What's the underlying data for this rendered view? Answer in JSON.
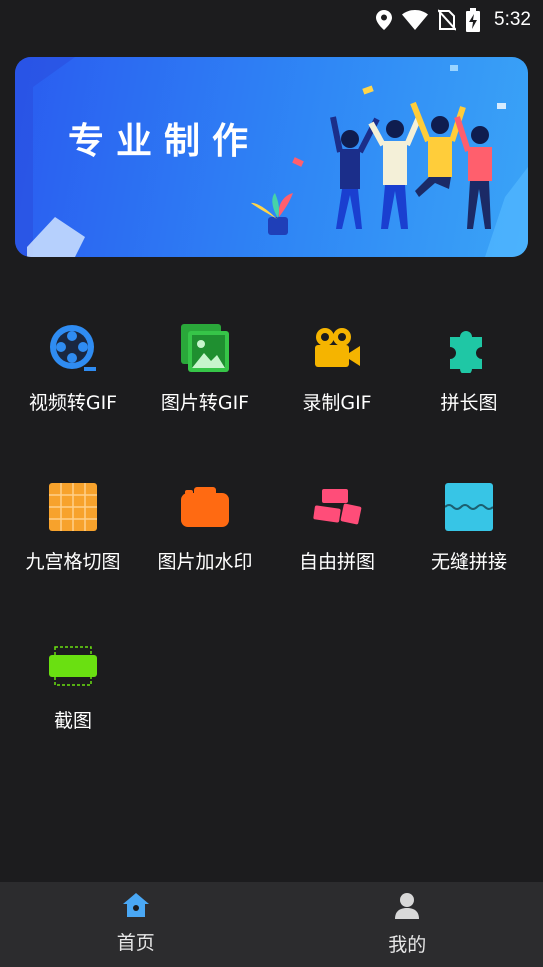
{
  "status_bar": {
    "time": "5:32",
    "icons": [
      "location-icon",
      "wifi-icon",
      "no-sim-icon",
      "battery-charging-icon"
    ]
  },
  "banner": {
    "title": "专业制作"
  },
  "tools": [
    {
      "label": "视频转GIF",
      "icon": "film-reel-icon",
      "color": "#2f8cf2"
    },
    {
      "label": "图片转GIF",
      "icon": "images-icon",
      "color": "#36c548"
    },
    {
      "label": "录制GIF",
      "icon": "video-camera-icon",
      "color": "#f5b400"
    },
    {
      "label": "拼长图",
      "icon": "puzzle-icon",
      "color": "#1fc7a5"
    },
    {
      "label": "九宫格切图",
      "icon": "grid-icon",
      "color": "#f7a22c"
    },
    {
      "label": "图片加水印",
      "icon": "camera-icon",
      "color": "#ff6a12"
    },
    {
      "label": "自由拼图",
      "icon": "collage-icon",
      "color": "#ff4d79"
    },
    {
      "label": "无缝拼接",
      "icon": "wave-icon",
      "color": "#37c5e6"
    },
    {
      "label": "截图",
      "icon": "screenshot-icon",
      "color": "#6ae011"
    }
  ],
  "bottom_nav": {
    "home_label": "首页",
    "mine_label": "我的",
    "active_color": "#4aa8f5"
  }
}
